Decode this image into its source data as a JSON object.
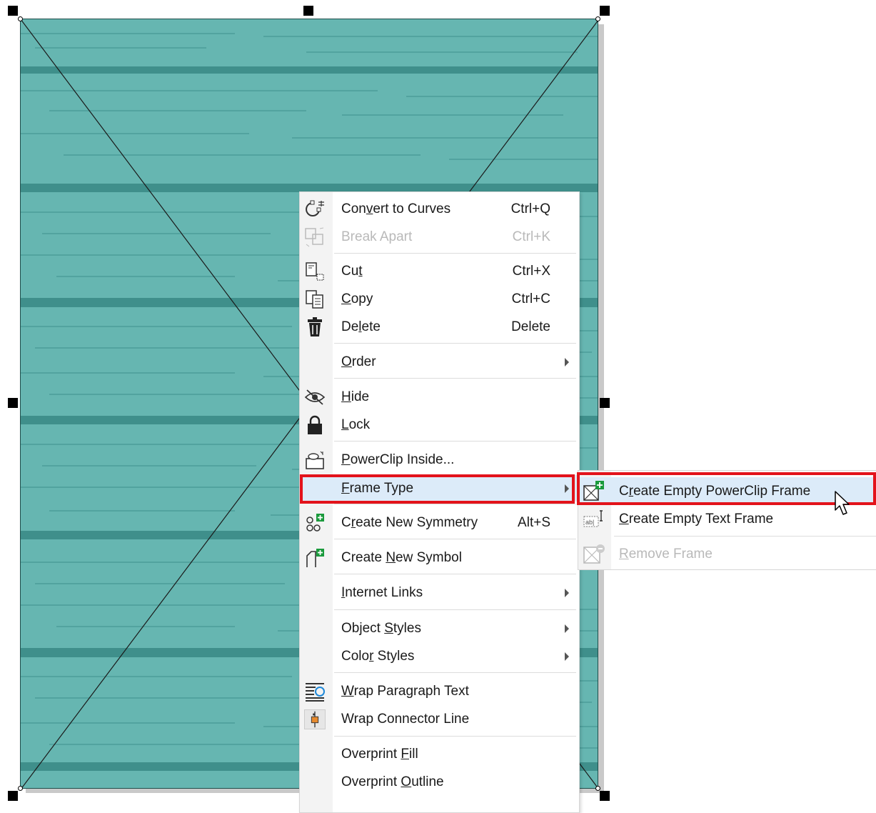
{
  "menu": {
    "items": [
      {
        "label_pre": "Con",
        "label_key": "v",
        "label_post": "ert to Curves",
        "shortcut": "Ctrl+Q",
        "icon": "convert-curves-icon"
      },
      {
        "label_pre": "Break Apart",
        "label_key": "",
        "label_post": "",
        "shortcut": "Ctrl+K",
        "icon": "break-apart-icon",
        "disabled": true
      },
      {
        "label_pre": "Cu",
        "label_key": "t",
        "label_post": "",
        "shortcut": "Ctrl+X",
        "icon": "cut-icon"
      },
      {
        "label_pre": "",
        "label_key": "C",
        "label_post": "opy",
        "shortcut": "Ctrl+C",
        "icon": "copy-icon"
      },
      {
        "label_pre": "De",
        "label_key": "l",
        "label_post": "ete",
        "shortcut": "Delete",
        "icon": "trash-icon"
      },
      {
        "label_pre": "",
        "label_key": "O",
        "label_post": "rder",
        "shortcut": "",
        "icon": "",
        "submenu": true
      },
      {
        "label_pre": "",
        "label_key": "H",
        "label_post": "ide",
        "shortcut": "",
        "icon": "hide-eye-icon"
      },
      {
        "label_pre": "",
        "label_key": "L",
        "label_post": "ock",
        "shortcut": "",
        "icon": "lock-icon"
      },
      {
        "label_pre": "",
        "label_key": "P",
        "label_post": "owerClip Inside...",
        "shortcut": "",
        "icon": "powerclip-icon"
      },
      {
        "label_pre": "",
        "label_key": "F",
        "label_post": "rame Type",
        "shortcut": "",
        "icon": "",
        "submenu": true,
        "highlight": true
      },
      {
        "label_pre": "C",
        "label_key": "r",
        "label_post": "eate New Symmetry",
        "shortcut": "Alt+S",
        "icon": "symmetry-icon"
      },
      {
        "label_pre": "Create ",
        "label_key": "N",
        "label_post": "ew Symbol",
        "shortcut": "",
        "icon": "new-symbol-icon"
      },
      {
        "label_pre": "",
        "label_key": "I",
        "label_post": "nternet Links",
        "shortcut": "",
        "icon": "",
        "submenu": true
      },
      {
        "label_pre": "Object ",
        "label_key": "S",
        "label_post": "tyles",
        "shortcut": "",
        "icon": "",
        "submenu": true
      },
      {
        "label_pre": "Colo",
        "label_key": "r",
        "label_post": " Styles",
        "shortcut": "",
        "icon": "",
        "submenu": true
      },
      {
        "label_pre": "",
        "label_key": "W",
        "label_post": "rap Paragraph Text",
        "shortcut": "",
        "icon": "wrap-text-icon"
      },
      {
        "label_pre": "Wrap Connector Line",
        "label_key": "",
        "label_post": "",
        "shortcut": "",
        "icon": "wrap-connector-icon"
      },
      {
        "label_pre": "Overprint ",
        "label_key": "F",
        "label_post": "ill",
        "shortcut": "",
        "icon": ""
      },
      {
        "label_pre": "Overprint ",
        "label_key": "O",
        "label_post": "utline",
        "shortcut": "",
        "icon": ""
      }
    ]
  },
  "submenu": {
    "items": [
      {
        "label_pre": "C",
        "label_key": "r",
        "label_post": "eate Empty PowerClip Frame",
        "icon": "powerclip-frame-add-icon",
        "highlight": true
      },
      {
        "label_pre": "",
        "label_key": "C",
        "label_post": "reate Empty Text Frame",
        "icon": "text-frame-icon"
      },
      {
        "label_pre": "",
        "label_key": "R",
        "label_post": "emove Frame",
        "icon": "remove-frame-icon",
        "disabled": true
      }
    ]
  },
  "colors": {
    "wood": "#66b6b1",
    "grain": "#3f8f8b",
    "menu_highlight": "#dcebf9",
    "annotation_red": "#e3131b"
  }
}
